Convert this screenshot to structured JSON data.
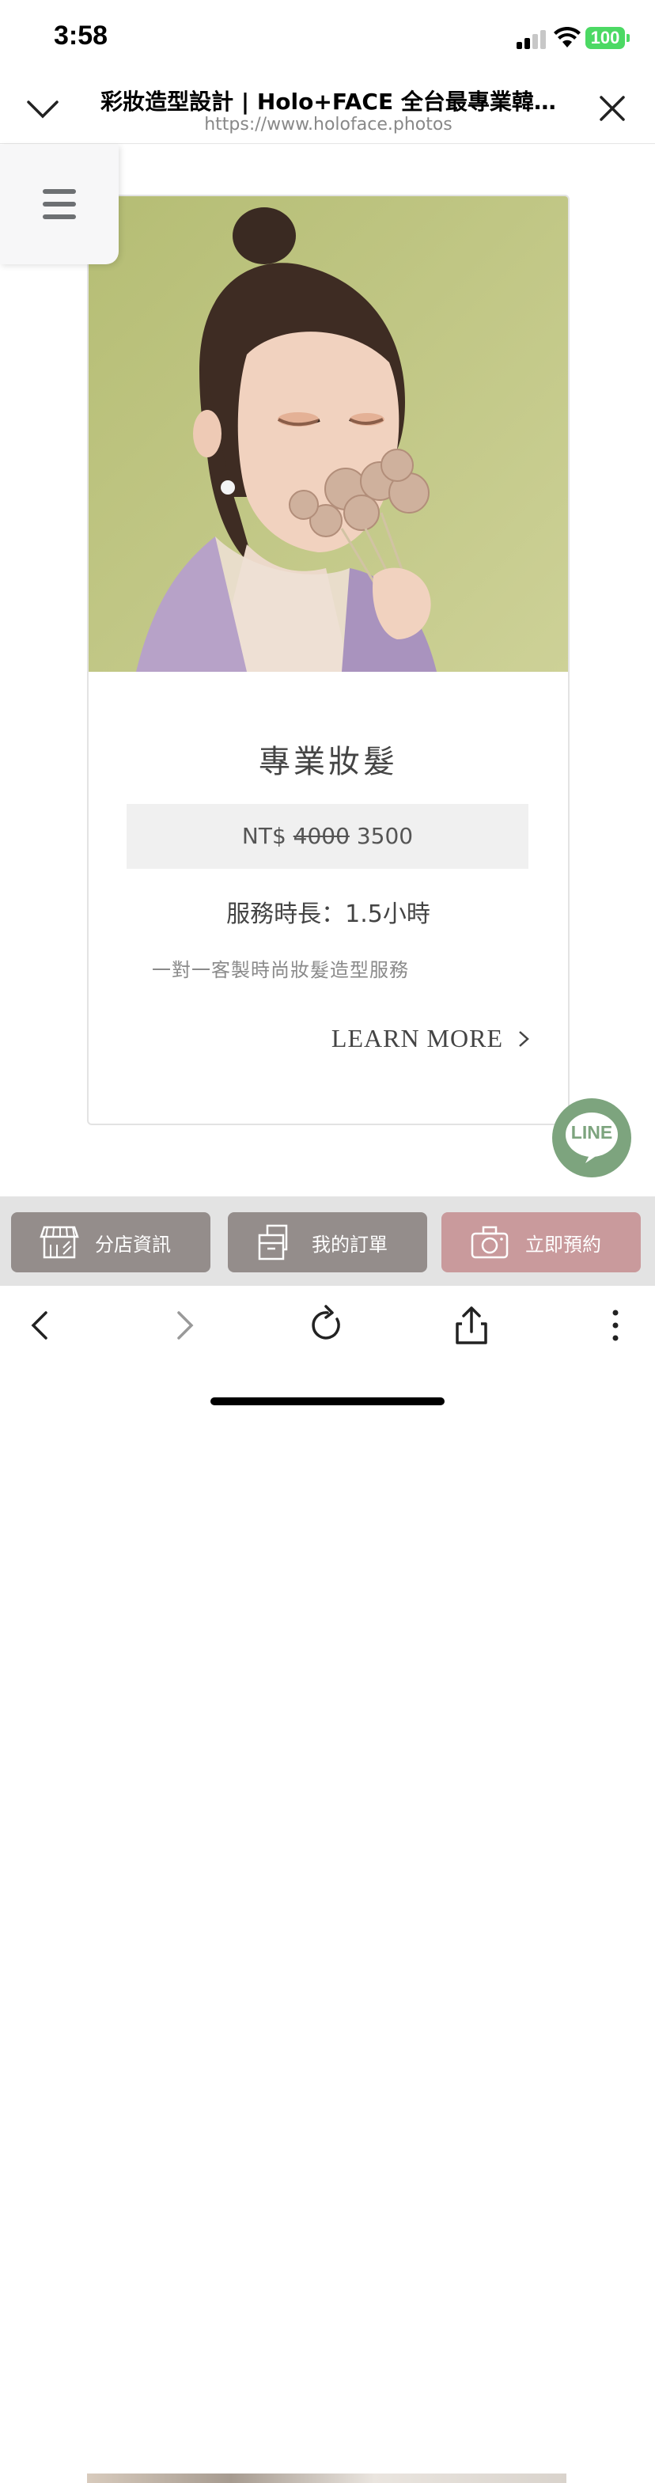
{
  "status_bar": {
    "time": "3:58",
    "battery": "100"
  },
  "browser": {
    "page_title": "彩妝造型設計 | Holo+FACE 全台最專業韓…",
    "url": "https://www.holoface.photos"
  },
  "card": {
    "title": "專業妝髮",
    "price_currency": "NT$",
    "price_old": "4000",
    "price_new": "3500",
    "duration": "服務時長：1.5小時",
    "description": "一對一客製時尚妝髮造型服務",
    "learn_more": "LEARN MORE"
  },
  "line_button": {
    "label": "LINE"
  },
  "action_bar": {
    "store": "分店資訊",
    "orders": "我的訂單",
    "book": "立即預約"
  },
  "colors": {
    "photo_background": "#c4c98c",
    "line_green": "#7da47e",
    "action_gray": "#948d8b",
    "action_pink": "#c99a9c"
  },
  "icons": [
    "chevron-down-icon",
    "close-icon",
    "hamburger-icon",
    "chevron-right-icon",
    "store-icon",
    "orders-icon",
    "camera-icon",
    "back-icon",
    "forward-icon",
    "reload-icon",
    "share-icon",
    "more-icon"
  ]
}
